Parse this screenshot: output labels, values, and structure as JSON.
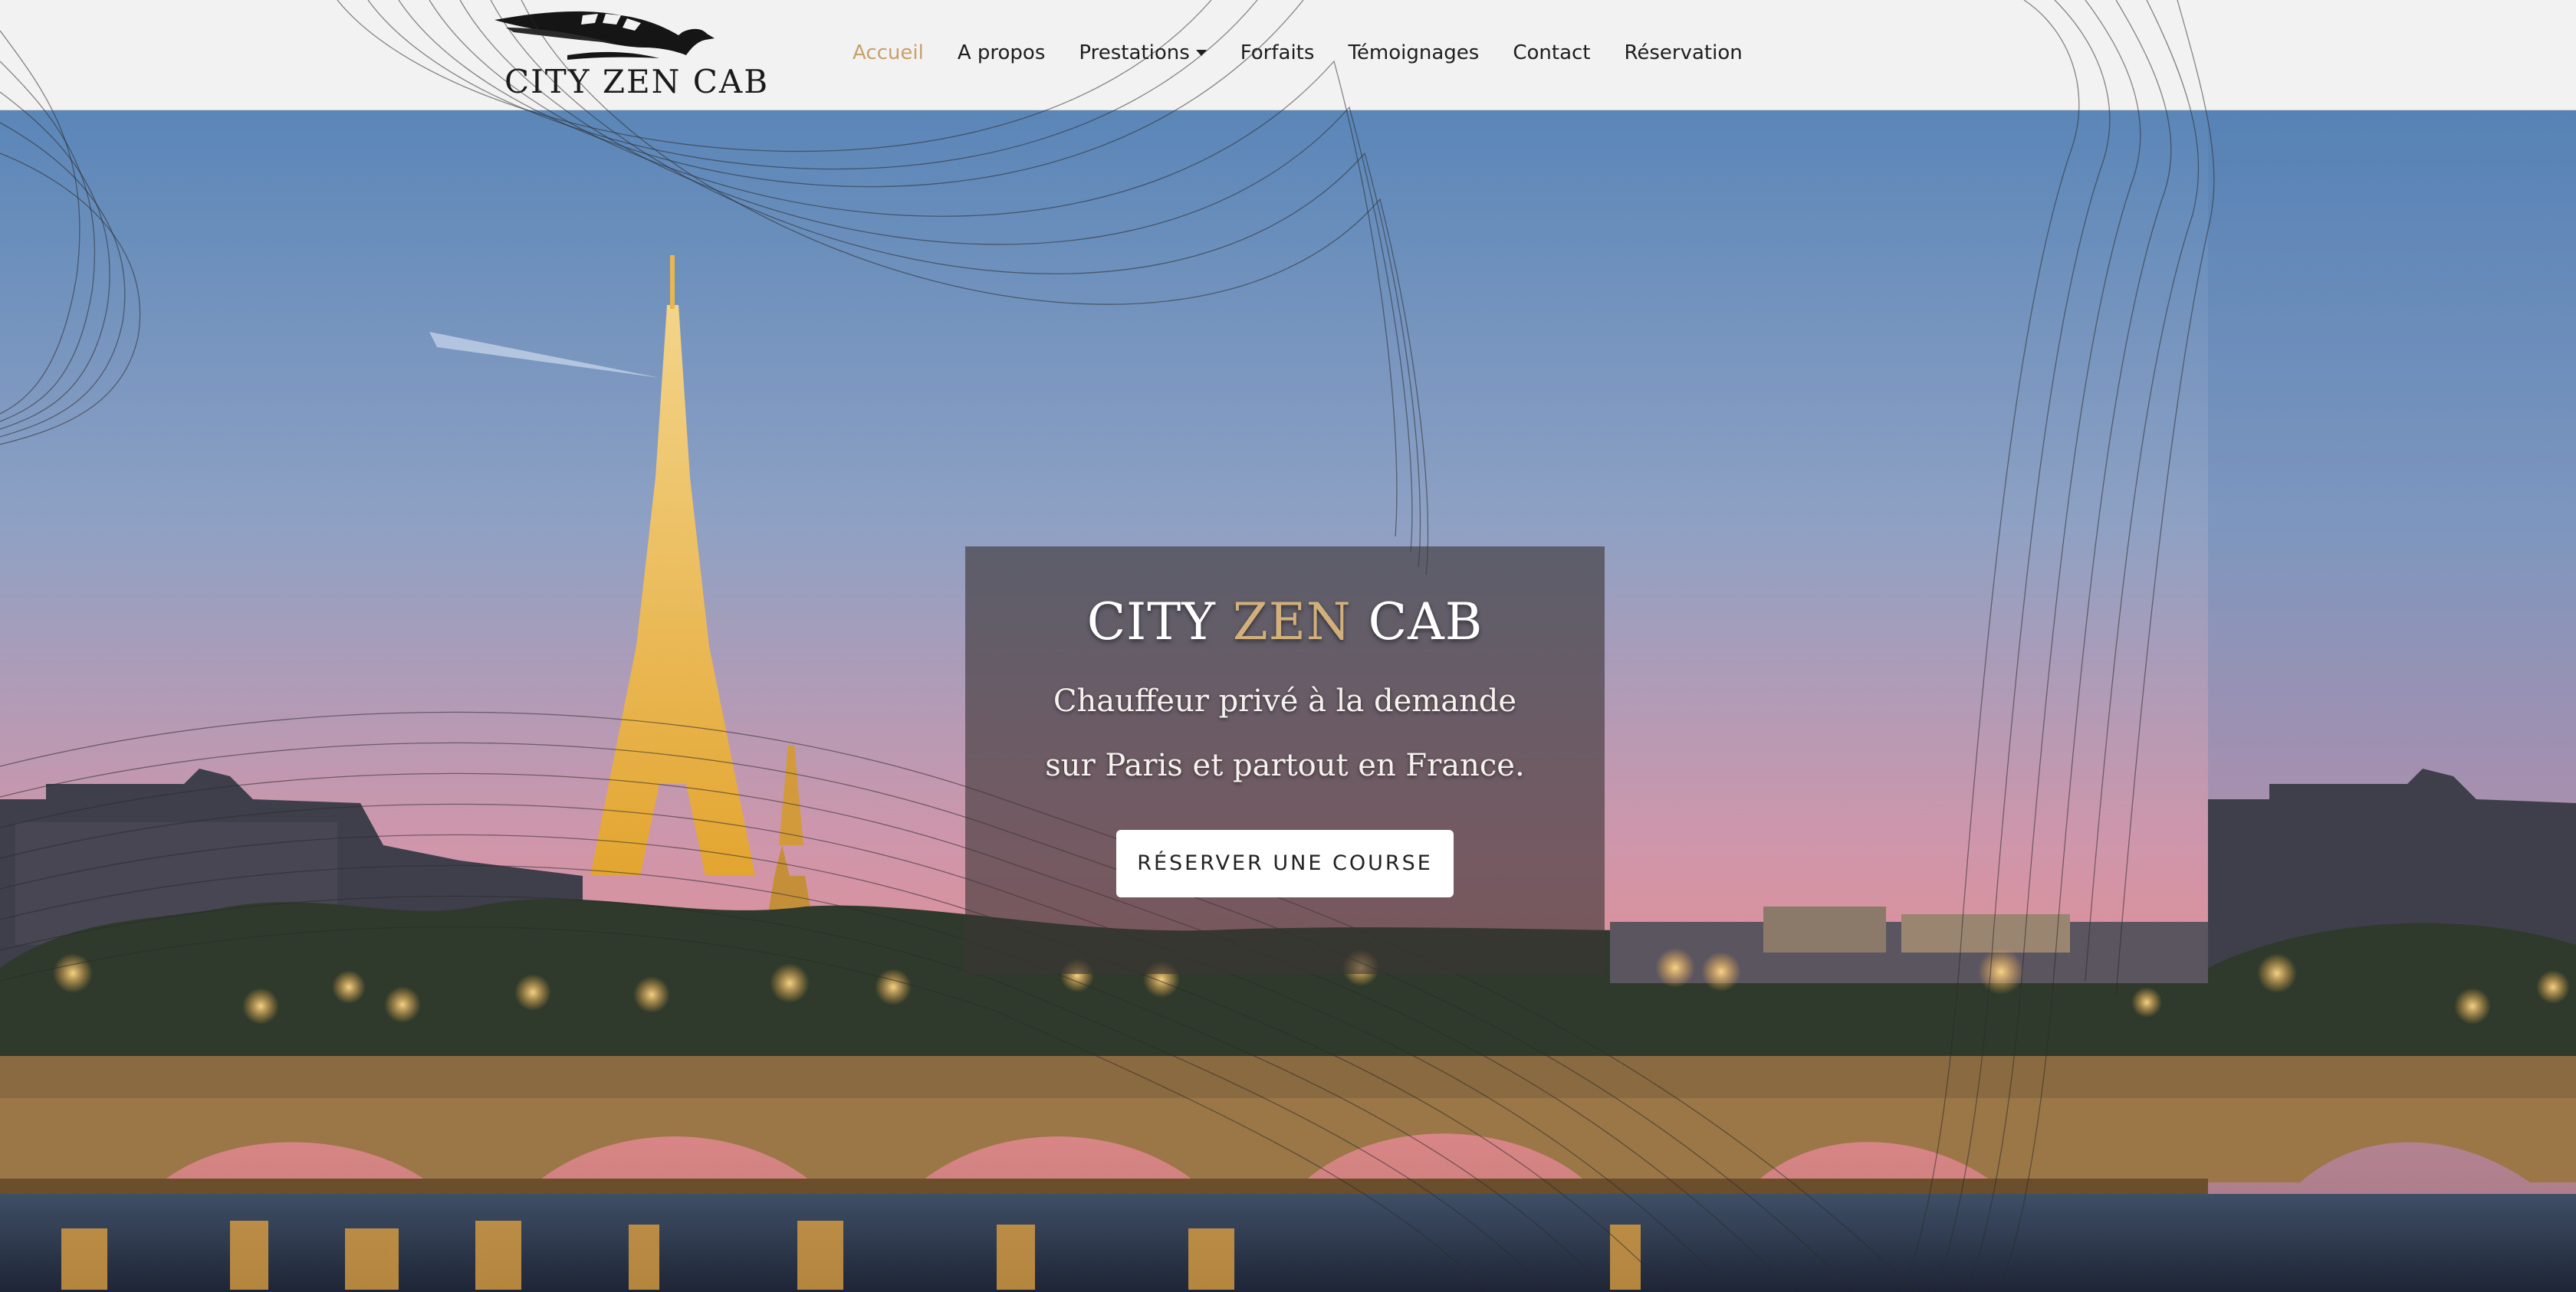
{
  "header": {
    "logo_text": "CITY ZEN CAB",
    "nav": [
      {
        "label": "Accueil",
        "active": true
      },
      {
        "label": "A propos"
      },
      {
        "label": "Prestations",
        "has_dropdown": true
      },
      {
        "label": "Forfaits"
      },
      {
        "label": "Témoignages"
      },
      {
        "label": "Contact"
      },
      {
        "label": "Réservation"
      }
    ]
  },
  "hero": {
    "title_part1": "CITY ",
    "title_accent": "ZEN",
    "title_part2": " CAB",
    "subtitle_line1": "Chauffeur privé à la demande",
    "subtitle_line2": "sur Paris et partout en France.",
    "cta_label": "RÉSERVER UNE COURSE"
  },
  "colors": {
    "accent": "#c9a06a",
    "header_bg": "#f2f2f2",
    "card_bg": "rgba(60,54,54,0.62)"
  },
  "icons": {
    "logo": "eagle-wing-logo-icon",
    "dropdown": "caret-down-icon"
  }
}
